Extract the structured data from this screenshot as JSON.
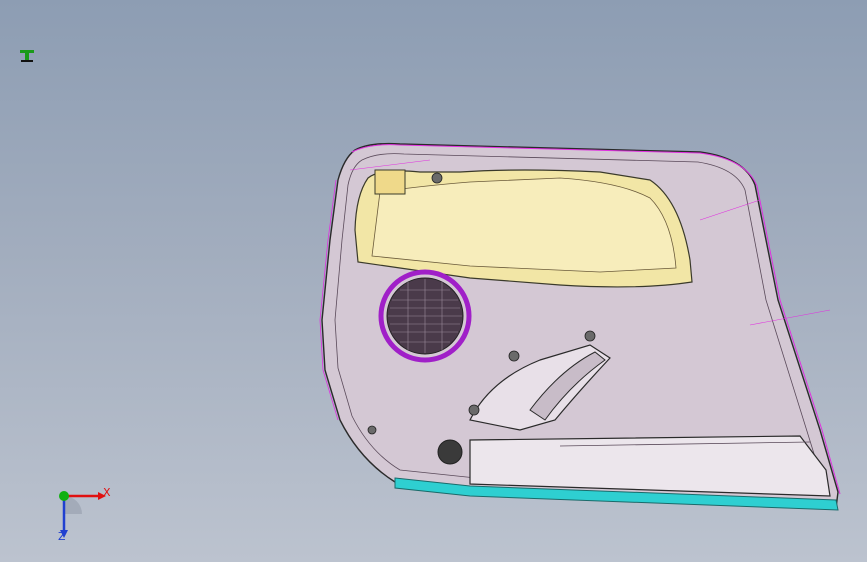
{
  "viewport": {
    "background_top": "#8d9db3",
    "background_bottom": "#bcc3cf",
    "model": {
      "panel_fill": "#d4c8d4",
      "armrest_fill": "#f2e6a6",
      "speaker_ring": "#a020c8",
      "bottom_strip": "#2ecfd1",
      "edge_line": "#e030e0"
    }
  },
  "corner_icon": "cursor-marker-icon",
  "triad": {
    "x_label": "X",
    "z_label": "Z",
    "x_color": "#e01010",
    "y_color": "#10b010",
    "z_color": "#2040d0"
  }
}
